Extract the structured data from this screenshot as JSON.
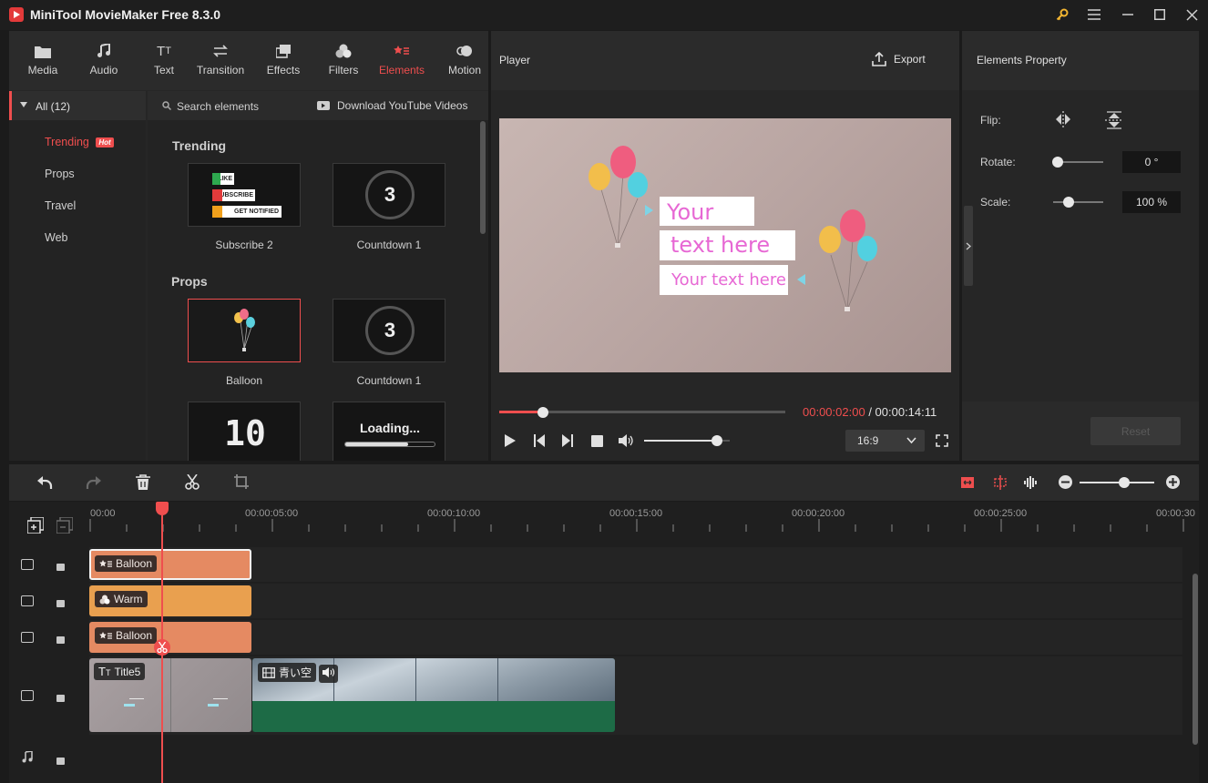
{
  "app": {
    "title": "MiniTool MovieMaker Free 8.3.0"
  },
  "tabs": [
    {
      "label": "Media",
      "icon": "folder-icon"
    },
    {
      "label": "Audio",
      "icon": "music-icon"
    },
    {
      "label": "Text",
      "icon": "text-icon"
    },
    {
      "label": "Transition",
      "icon": "transition-icon"
    },
    {
      "label": "Effects",
      "icon": "effects-icon"
    },
    {
      "label": "Filters",
      "icon": "filters-icon"
    },
    {
      "label": "Elements",
      "icon": "elements-icon",
      "active": true
    },
    {
      "label": "Motion",
      "icon": "motion-icon"
    }
  ],
  "categories": {
    "header": "All (12)",
    "items": [
      "Trending",
      "Props",
      "Travel",
      "Web"
    ],
    "hot_badge": "Hot"
  },
  "elements": {
    "search_placeholder": "Search elements",
    "download_link": "Download YouTube Videos",
    "sections": [
      {
        "title": "Trending",
        "items": [
          "Subscribe 2",
          "Countdown 1"
        ]
      },
      {
        "title": "Props",
        "items": [
          "Balloon",
          "Countdown 1"
        ]
      }
    ],
    "subscribe_lines": [
      "LIKE",
      "SUBSCRIBE",
      "GET NOTIFIED"
    ],
    "countdown_digit": "3",
    "big_number": "10",
    "loading_text": "Loading..."
  },
  "player": {
    "title": "Player",
    "export_label": "Export",
    "video_texts": [
      "Your",
      "text here",
      "Your text here"
    ],
    "current_time": "00:00:02:00",
    "total_time": "/ 00:00:14:11",
    "progress": 0.154,
    "volume": 0.85,
    "aspect": "16:9"
  },
  "property": {
    "title": "Elements Property",
    "flip_label": "Flip:",
    "rotate_label": "Rotate:",
    "rotate_value": "0 °",
    "rotate_level": 0.0,
    "scale_label": "Scale:",
    "scale_value": "100 %",
    "scale_level": 0.3,
    "reset_label": "Reset"
  },
  "timeline": {
    "zoom_level": 0.6,
    "ticks": [
      "00:00",
      "00:00:05:00",
      "00:00:10:00",
      "00:00:15:00",
      "00:00:20:00",
      "00:00:25:00",
      "00:00:30"
    ],
    "clips": {
      "track1": "Balloon",
      "track2": "Warm",
      "track3": "Balloon",
      "title_clip": "Title5",
      "video_clip": "青い空"
    }
  },
  "colors": {
    "accent": "#ef4e4e",
    "clip_orange": "#e8885e",
    "clip_filter": "#e9a04f",
    "audio_green": "#1d6b46"
  }
}
